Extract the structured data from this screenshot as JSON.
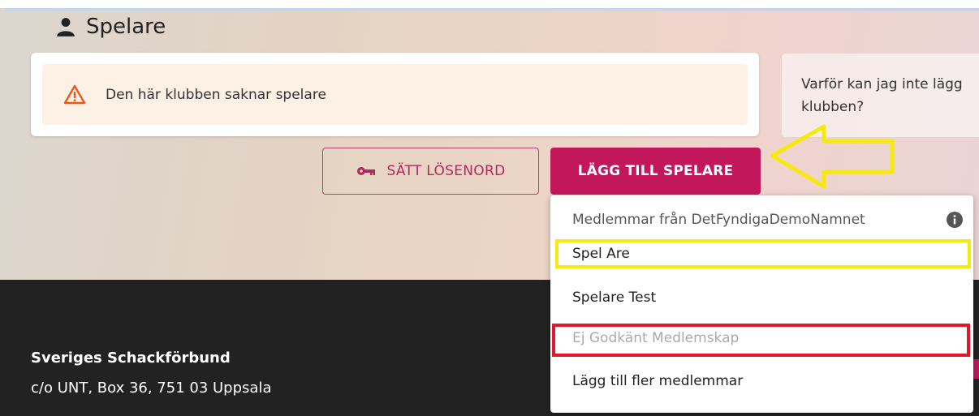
{
  "section": {
    "title": "Spelare",
    "icon": "person-icon"
  },
  "alert": {
    "icon": "warning-icon",
    "message": "Den här klubben saknar spelare"
  },
  "side_card": {
    "line1": "Varför kan jag inte lägg",
    "line2": "klubben?"
  },
  "buttons": {
    "set_password": {
      "label": "SÄTT LÖSENORD",
      "icon": "key-icon"
    },
    "add_player": {
      "label": "LÄGG TILL SPELARE"
    }
  },
  "dropdown": {
    "header": "Medlemmar från DetFyndigaDemoNamnet",
    "header_icon": "info-icon",
    "items": [
      {
        "label": "Spel Are",
        "disabled": false
      },
      {
        "label": "Spelare Test",
        "disabled": false
      },
      {
        "label": "Ej Godkänt Medlemskap",
        "disabled": true
      },
      {
        "label": "Lägg till fler medlemmar",
        "disabled": false
      }
    ]
  },
  "footer": {
    "org": "Sveriges Schackförbund",
    "address": "c/o UNT, Box 36, 751 03 Uppsala"
  },
  "colors": {
    "accent": "#c2185b",
    "highlight_yellow": "#f5e90f",
    "highlight_red": "#e0192a",
    "warning": "#e8591a",
    "footer_bg": "#222222"
  }
}
